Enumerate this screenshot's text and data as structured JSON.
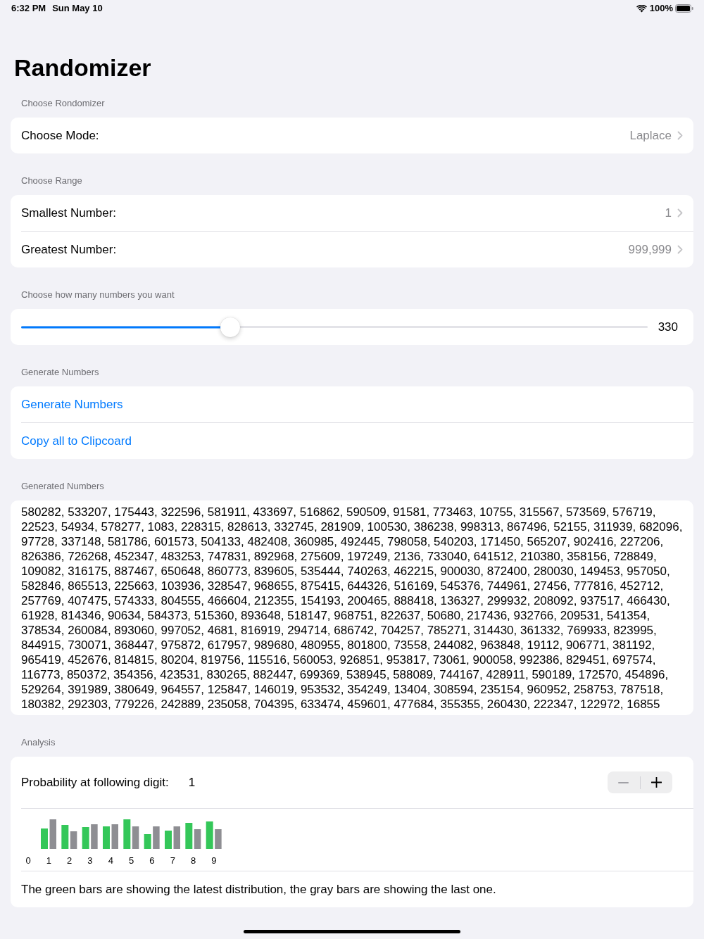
{
  "status_bar": {
    "time": "6:32 PM",
    "date": "Sun May 10",
    "battery": "100%"
  },
  "title": "Randomizer",
  "sections": [
    {
      "kind": "rows",
      "header": "Choose Rondomizer",
      "rows": [
        {
          "label": "Choose Mode:",
          "value": "Laplace"
        }
      ]
    },
    {
      "kind": "rows",
      "header": "Choose Range",
      "rows": [
        {
          "label": "Smallest Number:",
          "value": "1"
        },
        {
          "label": "Greatest Number:",
          "value": "999,999"
        }
      ]
    },
    {
      "kind": "slider",
      "header": "Choose how many numbers you want",
      "level": 0.334,
      "reading": "330"
    },
    {
      "kind": "actions",
      "header": "Generate Numbers",
      "actions": [
        "Generate Numbers",
        "Copy all to Clipcoard"
      ]
    },
    {
      "kind": "output",
      "header": "Generated Numbers",
      "text": "580282, 533207, 175443, 322596, 581911, 433697, 516862, 590509, 91581, 773463, 10755, 315567, 573569, 576719,\n22523, 54934, 578277, 1083, 228315, 828613, 332745, 281909, 100530, 386238, 998313, 867496, 52155, 311939, 682096,\n97728, 337148, 581786, 601573, 504133, 482408, 360985, 492445, 798058, 540203, 171450, 565207, 902416, 227206,\n826386, 726268, 452347, 483253, 747831, 892968, 275609, 197249, 2136, 733040, 641512, 210380, 358156, 728849,\n109082, 316175, 887467, 650648, 860773, 839605, 535444, 740263, 462215, 900030, 872400, 280030, 149453, 957050,\n582846, 865513, 225663, 103936, 328547, 968655, 875415, 644326, 516169, 545376, 744961, 27456, 777816, 452712,\n257769, 407475, 574333, 804555, 466604, 212355, 154193, 200465, 888418, 136327, 299932, 208092, 937517, 466430,\n61928, 814346, 90634, 584373, 515360, 893648, 518147, 968751, 822637, 50680, 217436, 932766, 209531, 541354,\n378534, 260084, 893060, 997052, 4681, 816919, 294714, 686742, 704257, 785271, 314430, 361332, 769933, 823995,\n844915, 730071, 368447, 975872, 617957, 989680, 480955, 801800, 73558, 244082, 963848, 19112, 906771, 381192,\n965419, 452676, 814815, 80204, 819756, 115516, 560053, 926851, 953817, 73061, 900058, 992386, 829451, 697574,\n116773, 850372, 354356, 423531, 830265, 882447, 699369, 538945, 588089, 744167, 428911, 590189, 172570, 454896,\n529264, 391989, 380649, 964557, 125847, 146019, 953532, 354249, 13404, 308594, 235154, 960952, 258753, 787518,\n180382, 292303, 779226, 242889, 235058, 704395, 633474, 459601, 477684, 355355, 260430, 222347, 122972, 16855"
    },
    {
      "kind": "analysis",
      "header": "Analysis",
      "label": "Probability at following digit:",
      "digit": "1",
      "stepper": {
        "decrement_disabled": true
      },
      "digit_labels": [
        "0",
        "1",
        "2",
        "3",
        "4",
        "5",
        "6",
        "7",
        "8",
        "9"
      ],
      "caption": "The green bars are showing the latest distribution, the gray bars are showing the last one."
    }
  ]
}
